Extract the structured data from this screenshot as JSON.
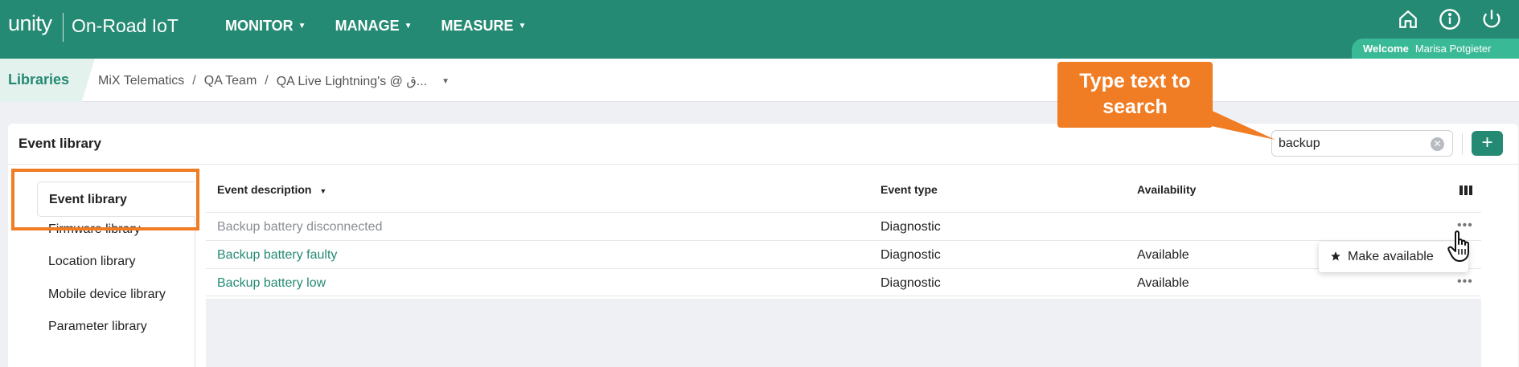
{
  "topbar": {
    "logo": "unity",
    "app_title": "On-Road IoT",
    "nav": [
      {
        "label": "MONITOR"
      },
      {
        "label": "MANAGE"
      },
      {
        "label": "MEASURE"
      }
    ],
    "icons": [
      "home-icon",
      "info-icon",
      "power-icon"
    ],
    "welcome_label": "Welcome",
    "user_name": "Marisa Potgieter"
  },
  "breadcrumb": {
    "section": "Libraries",
    "items": [
      "MiX Telematics",
      "QA Team",
      "QA Live Lightning's @ ق..."
    ]
  },
  "card": {
    "title": "Event library",
    "search_value": "backup"
  },
  "sidebar": {
    "items": [
      "Event library",
      "Firmware library",
      "Location library",
      "Mobile device library",
      "Parameter library"
    ]
  },
  "table": {
    "headers": [
      "Event description",
      "Event type",
      "Availability"
    ],
    "rows": [
      {
        "description": "Backup battery disconnected",
        "type": "Diagnostic",
        "availability": ""
      },
      {
        "description": "Backup battery faulty",
        "type": "Diagnostic",
        "availability": "Available"
      },
      {
        "description": "Backup battery low",
        "type": "Diagnostic",
        "availability": "Available"
      }
    ]
  },
  "popup": {
    "label": "Make available"
  },
  "callout": {
    "text": "Type text to search"
  },
  "colors": {
    "brand": "#258a73",
    "accent_orange": "#f07c23",
    "welcome_green": "#3ab996"
  }
}
